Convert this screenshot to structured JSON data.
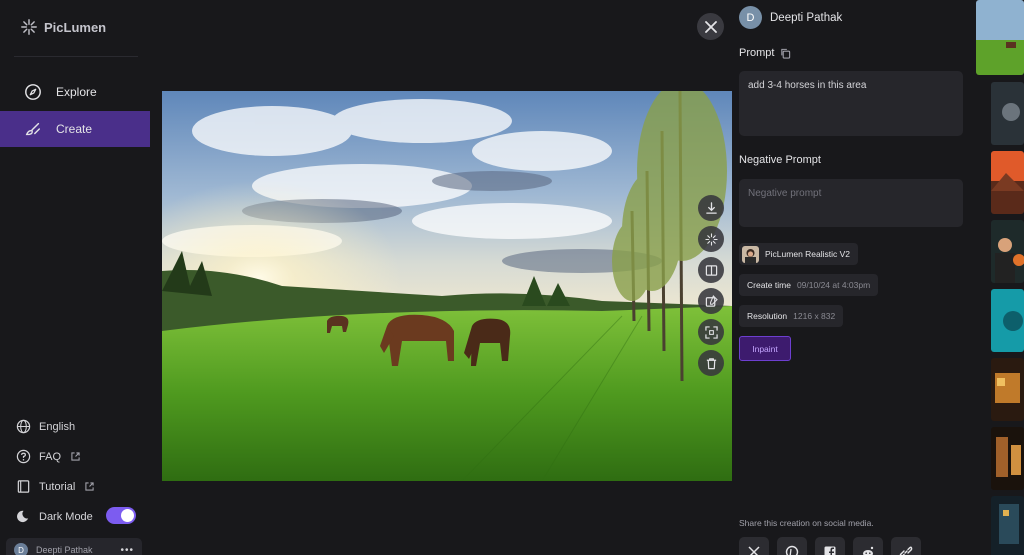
{
  "app": {
    "name": "PicLumen"
  },
  "nav": {
    "explore": "Explore",
    "create": "Create"
  },
  "sidebar_bottom": {
    "language": "English",
    "faq": "FAQ",
    "tutorial": "Tutorial",
    "dark_mode": "Dark Mode",
    "dark_mode_on": true,
    "user_name": "Deepti Pathak",
    "user_initial": "D"
  },
  "panel": {
    "author_initial": "D",
    "author_name": "Deepti Pathak",
    "prompt_label": "Prompt",
    "prompt_text": "add 3-4 horses in this area",
    "negative_label": "Negative Prompt",
    "negative_placeholder": "Negative prompt",
    "model": "PicLumen Realistic V2",
    "create_time_label": "Create time",
    "create_time_value": "09/10/24 at 4:03pm",
    "resolution_label": "Resolution",
    "resolution_value": "1216 x 832",
    "inpaint_label": "Inpaint",
    "share_text": "Share this creation on social media."
  },
  "icons": {
    "close": "close-icon",
    "download": "download-icon",
    "enhance": "sparkle-icon",
    "compare": "compare-icon",
    "edit": "edit-image-icon",
    "expand": "expand-icon",
    "delete": "trash-icon",
    "copy": "copy-icon"
  },
  "social": [
    "x-icon",
    "pinterest-icon",
    "facebook-icon",
    "reddit-icon",
    "link-icon"
  ],
  "colors": {
    "accent": "#7c5cf0",
    "active_nav": "#4a2f8a",
    "inpaint": "#3d1b6e"
  }
}
